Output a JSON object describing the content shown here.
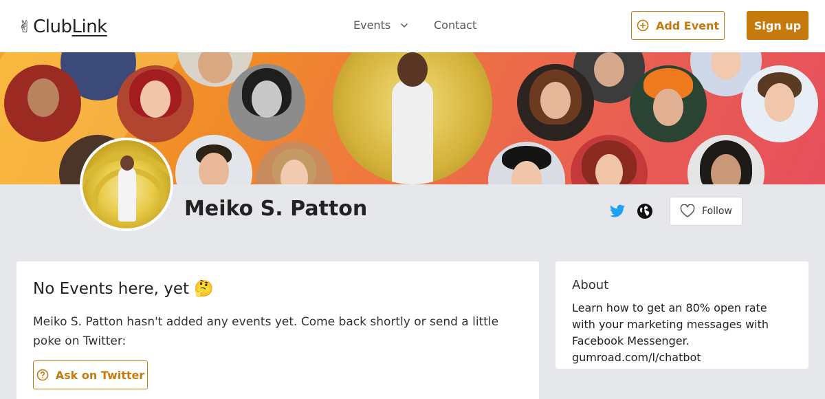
{
  "header": {
    "logo_icon": "✌",
    "logo_prefix": "Club",
    "logo_suffix": "Link",
    "nav_events_label": "Events",
    "nav_contact_label": "Contact",
    "add_event_label": "Add Event",
    "signup_label": "Sign up"
  },
  "profile": {
    "name": "Meiko S. Patton",
    "follow_label": "Follow"
  },
  "events_card": {
    "title": "No Events here, yet 🤔",
    "description": "Meiko S. Patton hasn't added any events yet. Come back shortly or send a little poke on Twitter:",
    "ask_button_label": "Ask on Twitter"
  },
  "about_card": {
    "title": "About",
    "description": "Learn how to get an 80% open rate with your marketing messages with Facebook Messenger. gumroad.com/l/chatbot"
  },
  "colors": {
    "accent": "#c67a0c",
    "page_bg": "#e6e7eb",
    "twitter_blue": "#1da1f2"
  },
  "icons": [
    "chevron-down-icon",
    "plus-circle-icon",
    "twitter-icon",
    "globe-icon",
    "heart-icon",
    "question-circle-icon"
  ]
}
